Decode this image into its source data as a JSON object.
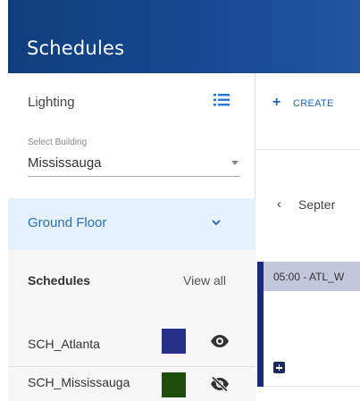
{
  "header": {
    "title": "Schedules"
  },
  "sidebar": {
    "category_label": "Lighting",
    "list_icon": "list-icon",
    "building_select": {
      "caption": "Select Building",
      "value": "Mississauga"
    },
    "floor": {
      "label": "Ground Floor",
      "icon": "chevron-down-icon"
    },
    "schedules": {
      "header": "Schedules",
      "view_all": "View all",
      "items": [
        {
          "name": "SCH_Atlanta",
          "color": "#243186",
          "visibility_icon": "eye-icon"
        },
        {
          "name": "SCH_Mississauga",
          "color": "#1f4d0b",
          "visibility_icon": "eye-off-icon"
        }
      ]
    }
  },
  "main": {
    "create_button": {
      "icon": "plus-icon",
      "label": "CREATE"
    },
    "month_nav": {
      "prev_icon": "chevron-left-icon",
      "month": "Septer"
    },
    "event": {
      "label": "05:00 - ATL_W"
    },
    "add_event_icon": "add-box-icon"
  },
  "colors": {
    "header_bg": "#174891",
    "accent": "#1e64b4",
    "selected_row_bg": "#e4f0fa",
    "calendar_accent": "#1c2a78"
  }
}
